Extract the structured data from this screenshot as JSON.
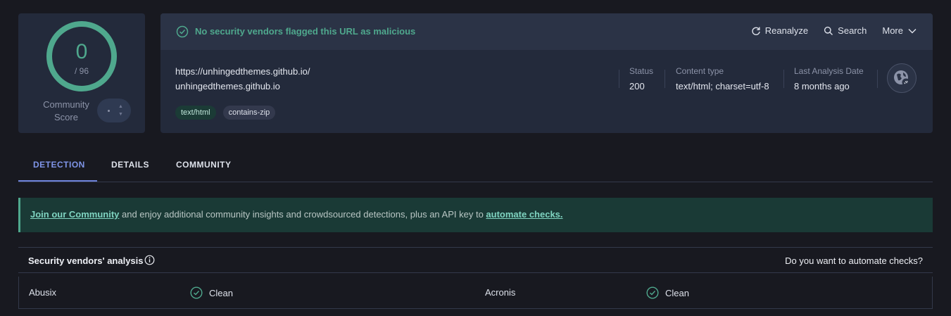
{
  "score": {
    "detections": "0",
    "total": "/ 96",
    "community_label": "Community Score",
    "ring_color": "#4fa88d"
  },
  "header": {
    "flag_text": "No security vendors flagged this URL as malicious",
    "actions": [
      "Reanalyze",
      "Search",
      "More"
    ]
  },
  "url": {
    "full": "https://unhingedthemes.github.io/",
    "host": "unhingedthemes.github.io",
    "tags": [
      "text/html",
      "contains-zip"
    ]
  },
  "meta": {
    "status_label": "Status",
    "status_value": "200",
    "content_type_label": "Content type",
    "content_type_value": "text/html; charset=utf-8",
    "last_analysis_label": "Last Analysis Date",
    "last_analysis_value": "8 months ago"
  },
  "tabs": [
    "DETECTION",
    "DETAILS",
    "COMMUNITY"
  ],
  "banner": {
    "link1": "Join our Community",
    "middle": " and enjoy additional community insights and crowdsourced detections, plus an API key to ",
    "link2": "automate checks."
  },
  "vendors": {
    "title": "Security vendors' analysis",
    "automate_prompt": "Do you want to automate checks?",
    "rows": [
      {
        "left_name": "Abusix",
        "left_result": "Clean",
        "right_name": "Acronis",
        "right_result": "Clean"
      }
    ]
  }
}
